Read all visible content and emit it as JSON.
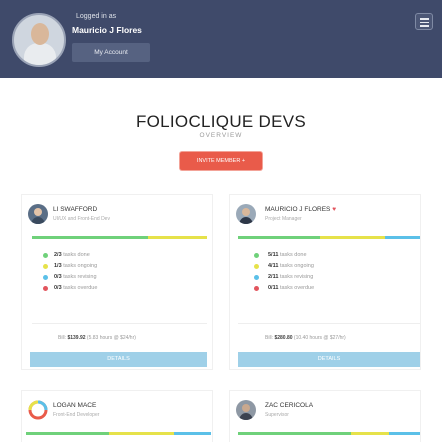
{
  "header": {
    "logged_in_label": "Logged in as",
    "user_name": "Mauricio J Flores",
    "account_button": "My Account"
  },
  "page": {
    "title": "FOLIOCLIQUE DEVS",
    "subtitle": "OVERVIEW",
    "invite_button": "INVITE MEMBER +"
  },
  "colors": {
    "done": "#6fd17a",
    "ongoing": "#e6e24a",
    "revising": "#5bc0e8",
    "overdue": "#e2555e",
    "header_bg": "#3f4a6a",
    "accent": "#e95b4a",
    "details_bg": "#9fd0e8"
  },
  "members": [
    {
      "name": "LI SWAFFORD",
      "role": "UI/UX and Front-End Dev",
      "heart": "",
      "tasks": [
        {
          "count": "2/3",
          "label": "tasks done",
          "status": "done"
        },
        {
          "count": "1/3",
          "label": "tasks ongoing",
          "status": "ongoing"
        },
        {
          "count": "0/3",
          "label": "tasks revising",
          "status": "revising"
        },
        {
          "count": "0/3",
          "label": "tasks overdue",
          "status": "overdue"
        }
      ],
      "bill_label": "Bill:",
      "bill_amount": "$139.92",
      "bill_detail": "(5.83 hours @ $24/hr)",
      "details_button": "DETAILS",
      "progress": {
        "done": 0.66,
        "ongoing": 0.34,
        "revising": 0,
        "overdue": 0
      }
    },
    {
      "name": "MAURICIO J FLORES",
      "role": "Project Manager",
      "heart": "♥",
      "tasks": [
        {
          "count": "5/11",
          "label": "tasks done",
          "status": "done"
        },
        {
          "count": "4/11",
          "label": "tasks ongoing",
          "status": "ongoing"
        },
        {
          "count": "2/11",
          "label": "tasks revising",
          "status": "revising"
        },
        {
          "count": "0/11",
          "label": "tasks overdue",
          "status": "overdue"
        }
      ],
      "bill_label": "Bill:",
      "bill_amount": "$280.80",
      "bill_detail": "(10.40 hours @ $27/hr)",
      "details_button": "DETAILS",
      "progress": {
        "done": 0.45,
        "ongoing": 0.36,
        "revising": 0.19,
        "overdue": 0
      }
    },
    {
      "name": "LOGAN MACE",
      "role": "Front-End Developer",
      "heart": "",
      "progress": {
        "done": 0.45,
        "ongoing": 0.35,
        "revising": 0.2,
        "overdue": 0
      }
    },
    {
      "name": "ZAC CERICOLA",
      "role": "Supervisor",
      "heart": "",
      "progress": {
        "done": 0.62,
        "ongoing": 0.21,
        "revising": 0.17,
        "overdue": 0
      }
    }
  ]
}
